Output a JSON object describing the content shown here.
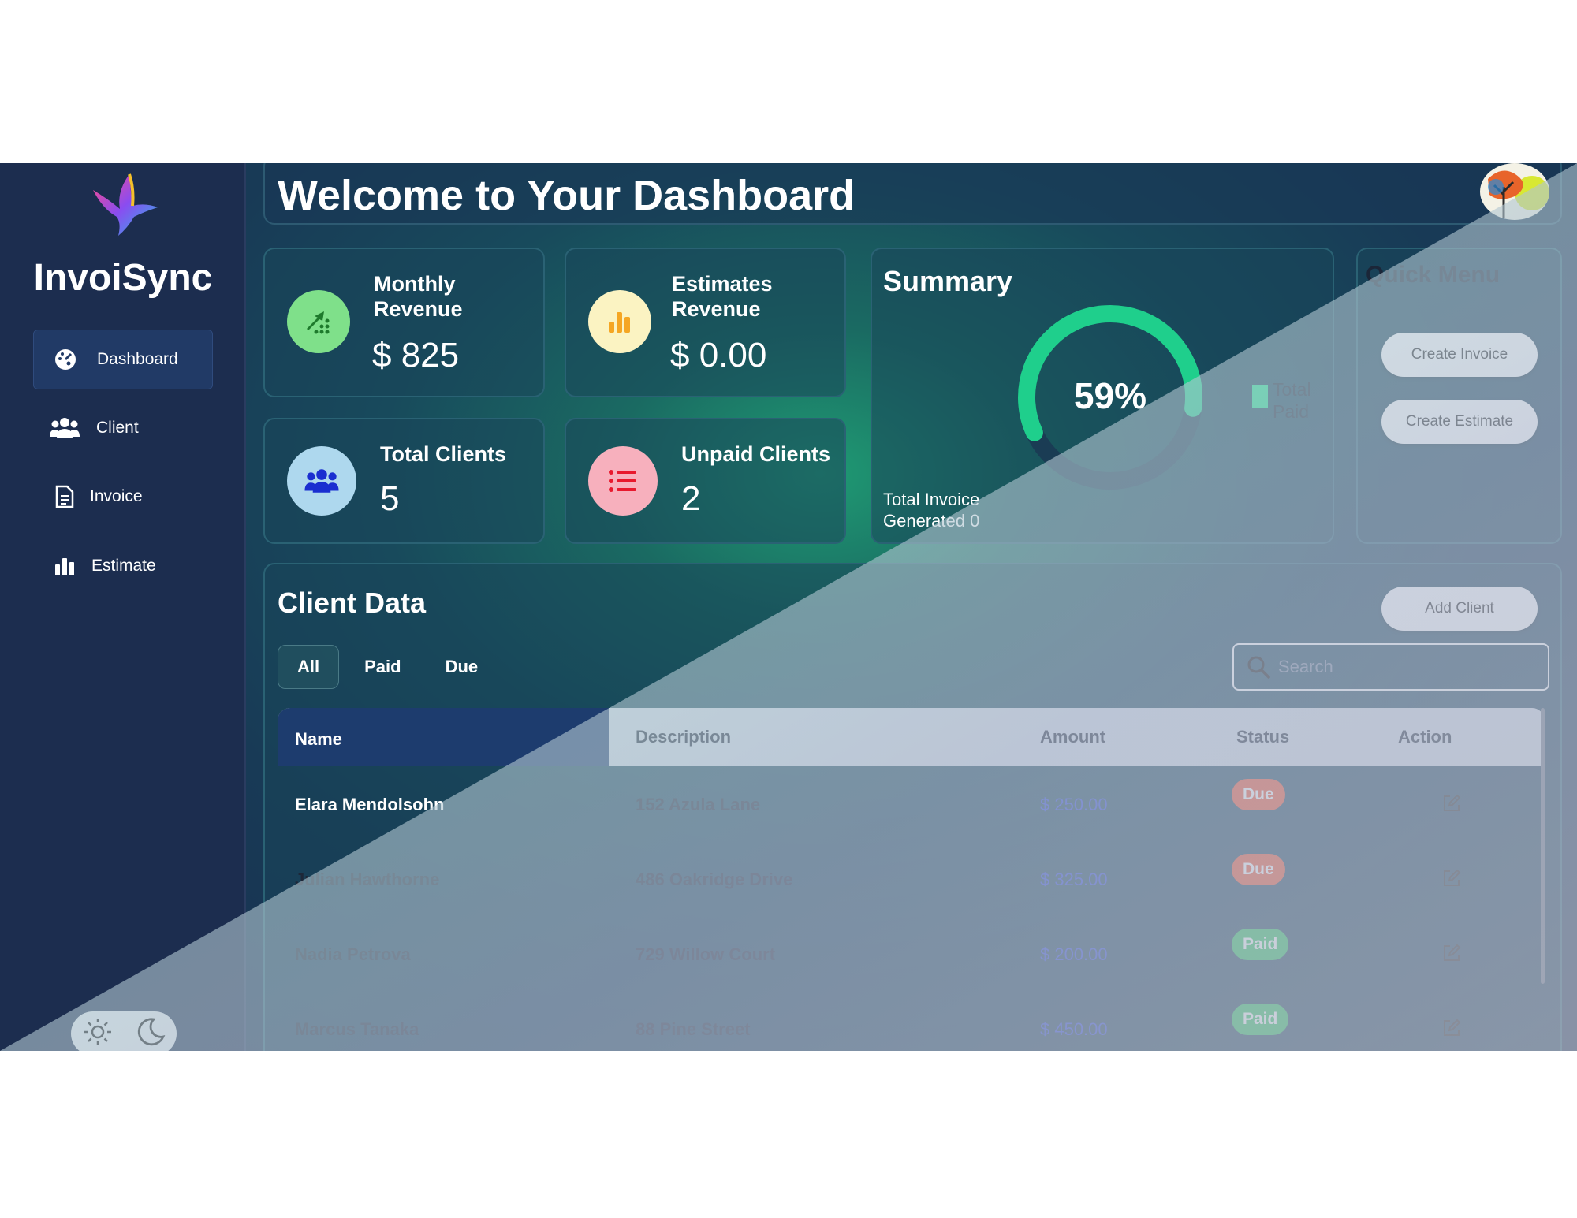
{
  "app": {
    "brand": "InvoiSync"
  },
  "sidebar": {
    "items": [
      {
        "label": "Dashboard",
        "icon": "dashboard-gauge-icon",
        "active": true
      },
      {
        "label": "Client",
        "icon": "users-icon"
      },
      {
        "label": "Invoice",
        "icon": "document-icon"
      },
      {
        "label": "Estimate",
        "icon": "bar-chart-icon"
      }
    ],
    "theme_icons": [
      "sun-icon",
      "moon-icon"
    ]
  },
  "header": {
    "title": "Welcome to Your Dashboard"
  },
  "stats": [
    {
      "title": "Monthly Revenue",
      "value": "$ 825",
      "icon": "growth-chart-icon",
      "color": "#7fe08a"
    },
    {
      "title": "Estimates Revenue",
      "value": "$ 0.00",
      "icon": "bar-chart-icon",
      "color": "#fbf3c2"
    },
    {
      "title": "Total Clients",
      "value": "5",
      "icon": "users-icon",
      "color": "#aed8ee"
    },
    {
      "title": "Unpaid Clients",
      "value": "2",
      "icon": "list-icon",
      "color": "#f7b0bd"
    }
  ],
  "summary": {
    "title": "Summary",
    "percent_label": "59%",
    "percent_value": 59,
    "legend": "Total Paid",
    "footer": "Total Invoice Generated 0",
    "colors": {
      "ring": "#1fcf8c",
      "legend": "#21e38f"
    }
  },
  "quick_menu": {
    "title": "Quick Menu",
    "buttons": [
      "Create Invoice",
      "Create Estimate"
    ]
  },
  "client_data": {
    "title": "Client Data",
    "add_button": "Add Client",
    "tabs": [
      "All",
      "Paid",
      "Due"
    ],
    "search_placeholder": "Search",
    "columns": [
      "Name",
      "Description",
      "Amount",
      "Status",
      "Action"
    ],
    "rows": [
      {
        "name": "Elara Mendolsohn",
        "description": "152 Azula Lane",
        "amount": "$ 250.00",
        "status": "Due"
      },
      {
        "name": "Julian Hawthorne",
        "description": "486 Oakridge Drive",
        "amount": "$ 325.00",
        "status": "Due"
      },
      {
        "name": "Nadia Petrova",
        "description": "729 Willow Court",
        "amount": "$ 200.00",
        "status": "Paid"
      },
      {
        "name": "Marcus Tanaka",
        "description": "88 Pine Street",
        "amount": "$ 450.00",
        "status": "Paid"
      }
    ]
  }
}
